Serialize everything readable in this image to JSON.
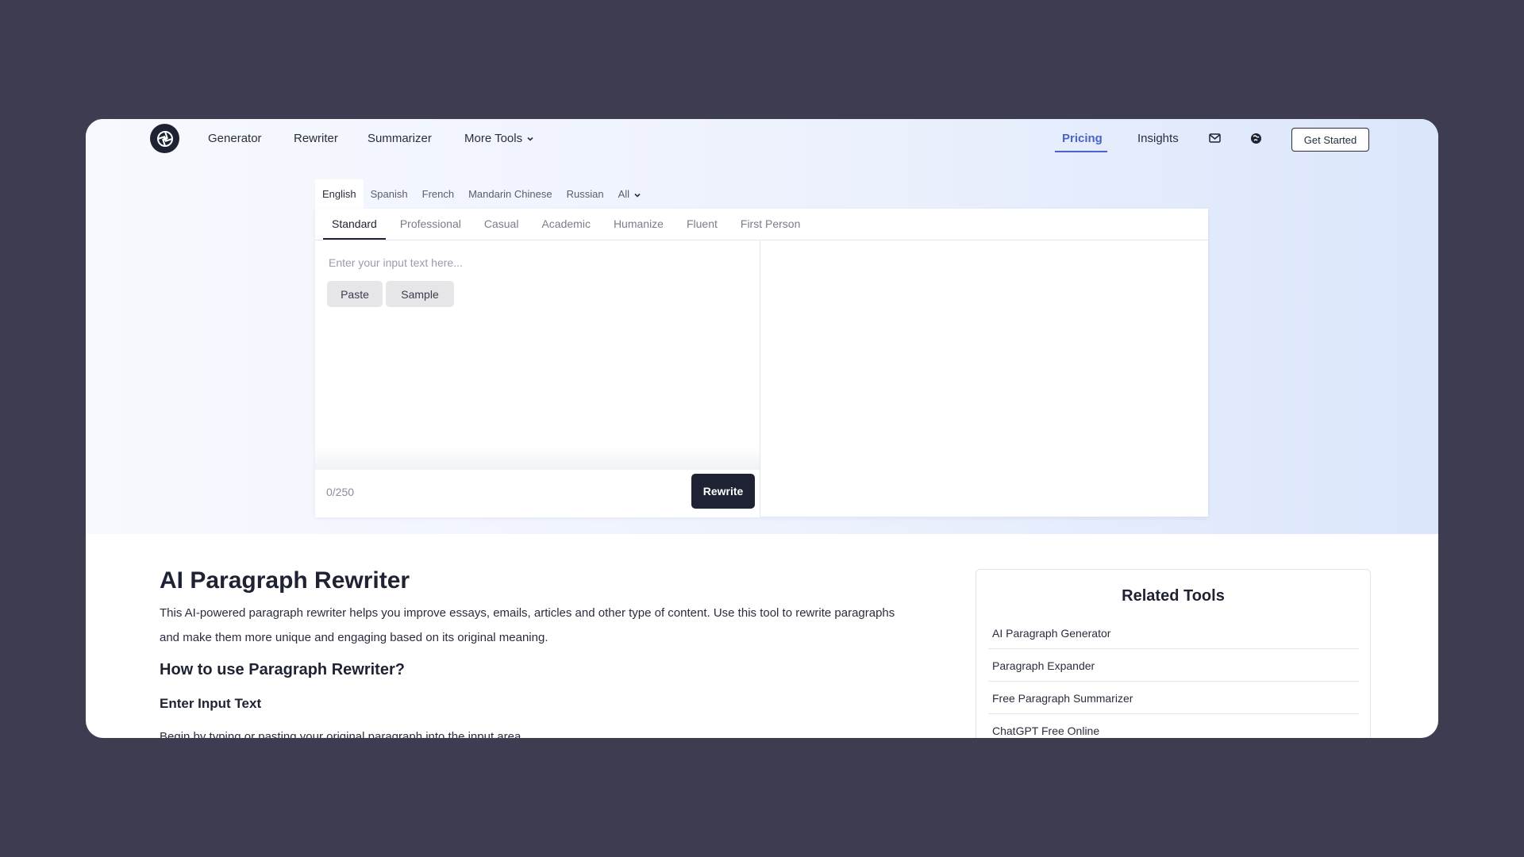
{
  "nav": {
    "logo_icon": "aperture-logo-icon",
    "links": [
      "Generator",
      "Rewriter",
      "Summarizer",
      "More Tools"
    ],
    "pricing": "Pricing",
    "insights": "Insights",
    "mail_icon": "mail-icon",
    "globe_icon": "globe-icon",
    "get_started": "Get Started",
    "accent_color": "#4a62c9"
  },
  "languages": {
    "items": [
      "English",
      "Spanish",
      "French",
      "Mandarin Chinese",
      "Russian",
      "All"
    ],
    "selected": "English"
  },
  "modes": {
    "items": [
      "Standard",
      "Professional",
      "Casual",
      "Academic",
      "Humanize",
      "Fluent",
      "First Person"
    ],
    "selected": "Standard"
  },
  "editor": {
    "placeholder": "Enter your input text here...",
    "value": "",
    "paste": "Paste",
    "sample": "Sample",
    "counter": "0/250",
    "rewrite": "Rewrite"
  },
  "content": {
    "title": "AI Paragraph Rewriter",
    "lead": "This AI-powered paragraph rewriter helps you improve essays, emails, articles and other type of content. Use this tool to rewrite paragraphs and make them more unique and engaging based on its original meaning.",
    "how_to": "How to use Paragraph Rewriter?",
    "step1_title": "Enter Input Text",
    "step1_text": "Begin by typing or pasting your original paragraph into the input area."
  },
  "related": {
    "title": "Related Tools",
    "items": [
      "AI Paragraph Generator",
      "Paragraph Expander",
      "Free Paragraph Summarizer",
      "ChatGPT Free Online"
    ]
  }
}
